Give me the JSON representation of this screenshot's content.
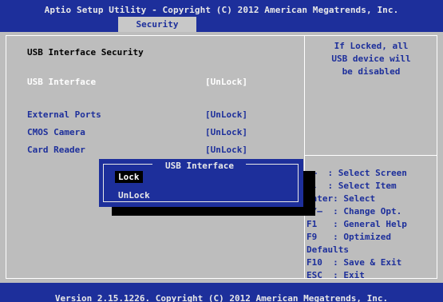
{
  "header": {
    "title": "Aptio Setup Utility - Copyright (C) 2012 American Megatrends, Inc.",
    "active_tab": "Security"
  },
  "main": {
    "section_title": "USB Interface Security",
    "rows": [
      {
        "label": "USB Interface",
        "value": "[UnLock]"
      },
      {
        "label": "External Ports",
        "value": "[UnLock]"
      },
      {
        "label": "CMOS Camera",
        "value": "[UnLock]"
      },
      {
        "label": "Card Reader",
        "value": "[UnLock]"
      }
    ]
  },
  "help": {
    "text": "If Locked, all\nUSB device will\nbe disabled"
  },
  "keys": [
    "→←  : Select Screen",
    "↑↓  : Select Item",
    "Enter: Select",
    "+/—  : Change Opt.",
    "F1   : General Help",
    "F9   : Optimized",
    "Defaults",
    "F10  : Save & Exit",
    "ESC  : Exit"
  ],
  "popup": {
    "title": "USB Interface",
    "options": [
      "Lock",
      "UnLock"
    ],
    "selected": "Lock"
  },
  "footer": {
    "text": "Version 2.15.1226. Copyright (C) 2012 American Megatrends, Inc."
  },
  "colors": {
    "bar_blue": "#1d2f9b",
    "panel_gray": "#bdbdbd",
    "text_blue": "#1d2f9b"
  }
}
